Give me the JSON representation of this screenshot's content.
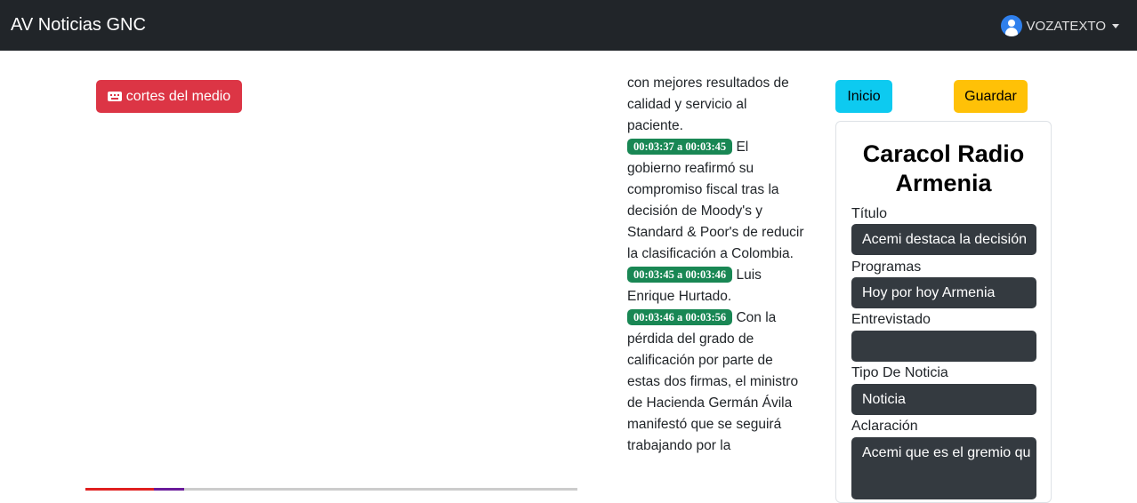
{
  "app": {
    "brand": "AV Noticias GNC",
    "user": "VOZATEXTO"
  },
  "toolbar": {
    "cortes_label": "cortes del medio",
    "inicio_label": "Inicio",
    "guardar_label": "Guardar"
  },
  "player": {
    "progress": 0.2
  },
  "transcript": {
    "lead_text": "con mejores resultados de calidad y servicio al paciente.",
    "segments": [
      {
        "time": "00:03:37 a 00:03:45",
        "text": "El gobierno reafirmó su compromiso fiscal tras la decisión de Moody's y Standard & Poor's de reducir la clasificación a Colombia."
      },
      {
        "time": "00:03:45 a 00:03:46",
        "text": "Luis Enrique Hurtado."
      },
      {
        "time": "00:03:46 a 00:03:56",
        "text": "Con la pérdida del grado de calificación por parte de estas dos firmas, el ministro de Hacienda Germán Ávila manifestó que se seguirá trabajando por la"
      }
    ]
  },
  "form": {
    "station": "Caracol Radio Armenia",
    "titulo_label": "Título",
    "titulo_value": "Acemi destaca la decisión",
    "programas_label": "Programas",
    "programas_value": "Hoy por hoy Armenia",
    "entrevistado_label": "Entrevistado",
    "entrevistado_value": "",
    "tipo_label": "Tipo De Noticia",
    "tipo_value": "Noticia",
    "aclaracion_label": "Aclaración",
    "aclaracion_value": "Acemi que es el gremio qu"
  },
  "colors": {
    "navbar": "#212529",
    "danger": "#dc3545",
    "info": "#0dcaf0",
    "warning": "#ffc107",
    "success": "#198754",
    "field": "#343a40"
  },
  "icons": {
    "user": "user-circle-icon",
    "cortes": "keyboard-icon",
    "menu": "caret-down-icon"
  }
}
